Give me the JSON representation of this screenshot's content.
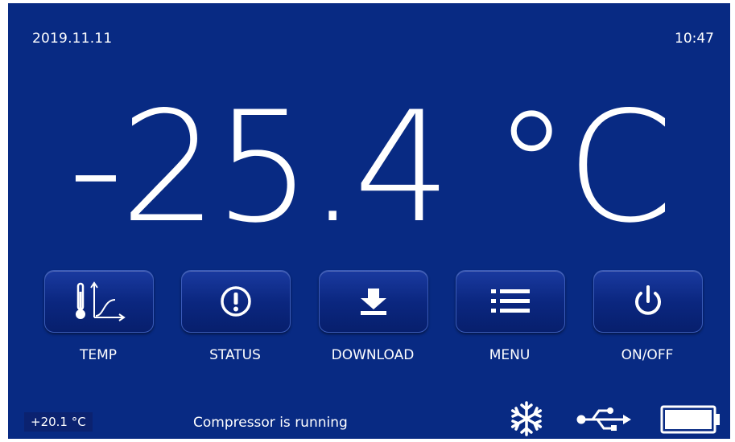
{
  "header": {
    "date": "2019.11.11",
    "time": "10:47"
  },
  "main": {
    "temperature": "-25.4 °C"
  },
  "buttons": [
    {
      "label": "TEMP",
      "icon": "thermometer-graph-icon"
    },
    {
      "label": "STATUS",
      "icon": "exclamation-circle-icon"
    },
    {
      "label": "DOWNLOAD",
      "icon": "download-icon"
    },
    {
      "label": "MENU",
      "icon": "menu-list-icon"
    },
    {
      "label": "ON/OFF",
      "icon": "power-icon"
    }
  ],
  "footer": {
    "ambient_temp": "+20.1 °C",
    "status_message": "Compressor is running",
    "icons": [
      "snowflake-icon",
      "usb-icon",
      "battery-icon"
    ]
  },
  "colors": {
    "background": "#082a83",
    "button": "#0b2780",
    "text": "#ffffff"
  }
}
